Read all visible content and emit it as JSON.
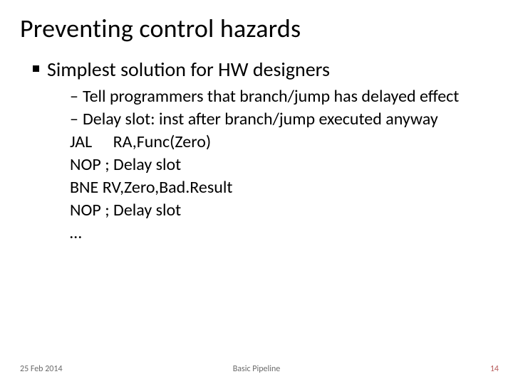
{
  "title": "Preventing control hazards",
  "bullet1": "Simplest solution for HW designers",
  "sub": {
    "a": "Tell programmers that branch/jump has delayed effect",
    "b": "Delay slot: inst after branch/jump executed anyway",
    "c1": "JAL  RA,Func(Zero)",
    "c2": "NOP ; Delay slot",
    "c3": "BNE RV,Zero,Bad.Result",
    "c4": "NOP ; Delay slot",
    "c5": "…"
  },
  "footer": {
    "date": "25 Feb 2014",
    "center": "Basic Pipeline",
    "page": "14"
  }
}
